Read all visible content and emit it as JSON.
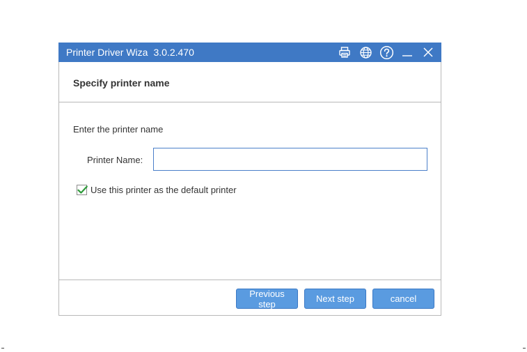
{
  "window": {
    "title": "Printer Driver Wiza",
    "version": "3.0.2.470"
  },
  "titlebar_icons": [
    "printer-icon",
    "globe-icon",
    "help-icon",
    "minimize-icon",
    "close-icon"
  ],
  "header": {
    "title": "Specify printer name"
  },
  "form": {
    "instruction": "Enter the printer name",
    "name_label": "Printer Name:",
    "name_value": "",
    "default_checkbox_label": "Use this printer as the default printer",
    "default_checked": true
  },
  "buttons": {
    "previous": "Previous step",
    "next": "Next step",
    "cancel": "cancel"
  },
  "colors": {
    "titlebar": "#3f79c5",
    "button": "#5a9be0",
    "checkmark": "#2e9a3a"
  }
}
